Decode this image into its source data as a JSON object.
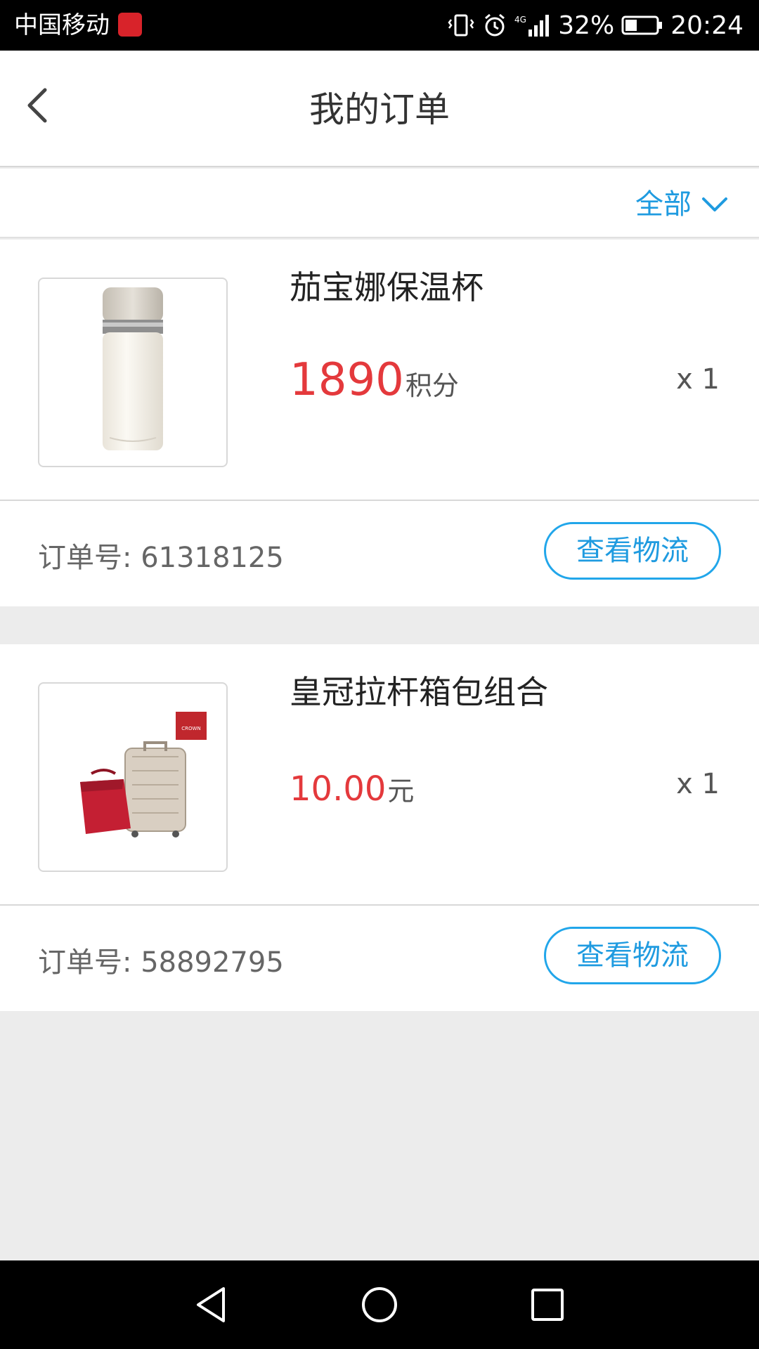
{
  "status_bar": {
    "carrier": "中国移动",
    "network": "4G",
    "battery": "32%",
    "time": "20:24"
  },
  "header": {
    "title": "我的订单"
  },
  "filter": {
    "label": "全部"
  },
  "orders": [
    {
      "product_name": "茄宝娜保温杯",
      "price": "1890",
      "unit": "积分",
      "quantity": "x 1",
      "order_no_label": "订单号: 61318125",
      "action": "查看物流"
    },
    {
      "product_name": "皇冠拉杆箱包组合",
      "price": "10.00",
      "unit": "元",
      "quantity": "x 1",
      "order_no_label": "订单号: 58892795",
      "action": "查看物流",
      "brand_badge": "CROWN"
    }
  ],
  "colors": {
    "accent": "#1f9be0",
    "price": "#e4393c"
  }
}
